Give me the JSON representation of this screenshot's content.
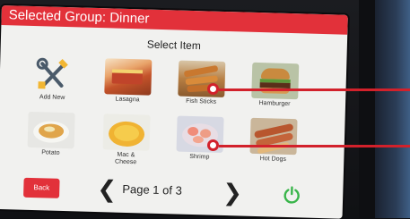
{
  "window": {
    "title": "Selected Group: Dinner"
  },
  "main": {
    "heading": "Select Item"
  },
  "items": [
    {
      "label": "Add New",
      "icon": "tools-icon"
    },
    {
      "label": "Lasagna",
      "icon": "lasagna-image"
    },
    {
      "label": "Fish Sticks",
      "icon": "fish-sticks-image"
    },
    {
      "label": "Hamburger",
      "icon": "hamburger-image"
    },
    {
      "label": "Potato",
      "icon": "potato-image"
    },
    {
      "label": "Mac &\nCheese",
      "icon": "mac-cheese-image"
    },
    {
      "label": "Shrimp",
      "icon": "shrimp-image"
    },
    {
      "label": "Hot Dogs",
      "icon": "hot-dogs-image"
    }
  ],
  "nav": {
    "back_label": "Back",
    "page_label": "Page 1 of 3",
    "prev_icon": "chevron-left-icon",
    "next_icon": "chevron-right-icon",
    "power_icon": "power-icon"
  },
  "colors": {
    "title_bar": "#e2313a",
    "callout": "#d2212b",
    "power": "#39b54a"
  }
}
